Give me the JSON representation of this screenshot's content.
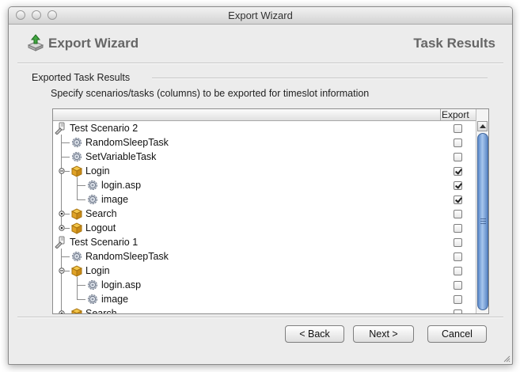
{
  "window": {
    "title": "Export Wizard"
  },
  "header": {
    "title": "Export Wizard",
    "step": "Task Results"
  },
  "section": {
    "title": "Exported Task Results",
    "instructions": "Specify scenarios/tasks (columns) to be exported for timeslot information"
  },
  "table": {
    "columns": [
      "",
      "Export"
    ],
    "rows": [
      {
        "label": "Test Scenario 2",
        "level": 0,
        "kind": "scenario",
        "expander": "none",
        "checked": false
      },
      {
        "label": "RandomSleepTask",
        "level": 1,
        "kind": "task",
        "expander": "none",
        "checked": false
      },
      {
        "label": "SetVariableTask",
        "level": 1,
        "kind": "task",
        "expander": "none",
        "checked": false
      },
      {
        "label": "Login",
        "level": 1,
        "kind": "group",
        "expander": "expanded",
        "checked": true
      },
      {
        "label": "login.asp",
        "level": 2,
        "kind": "task",
        "expander": "none",
        "checked": true
      },
      {
        "label": "image",
        "level": 2,
        "kind": "task",
        "expander": "none",
        "checked": true
      },
      {
        "label": "Search",
        "level": 1,
        "kind": "group",
        "expander": "collapsed",
        "checked": false
      },
      {
        "label": "Logout",
        "level": 1,
        "kind": "group",
        "expander": "collapsed",
        "checked": false
      },
      {
        "label": "Test Scenario 1",
        "level": 0,
        "kind": "scenario",
        "expander": "none",
        "checked": false
      },
      {
        "label": "RandomSleepTask",
        "level": 1,
        "kind": "task",
        "expander": "none",
        "checked": false
      },
      {
        "label": "Login",
        "level": 1,
        "kind": "group",
        "expander": "expanded",
        "checked": false
      },
      {
        "label": "login.asp",
        "level": 2,
        "kind": "task",
        "expander": "none",
        "checked": false
      },
      {
        "label": "image",
        "level": 2,
        "kind": "task",
        "expander": "none",
        "checked": false
      },
      {
        "label": "Search",
        "level": 1,
        "kind": "group",
        "expander": "collapsed",
        "checked": false
      }
    ]
  },
  "buttons": {
    "back": "< Back",
    "next": "Next >",
    "cancel": "Cancel"
  }
}
